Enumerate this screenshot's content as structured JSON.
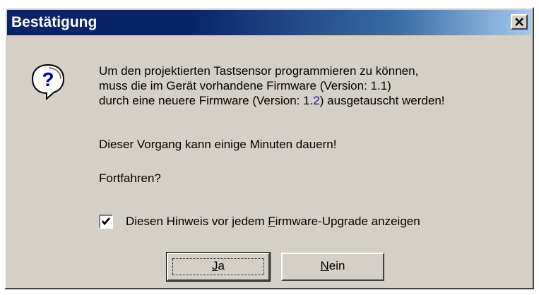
{
  "dialog": {
    "title": "Bestätigung",
    "close_label": "×",
    "icon": "question-icon",
    "message_lines": [
      {
        "text": "Um den projektierten Tastsensor programmieren zu können,"
      },
      {
        "text": "muss die im Gerät vorhandene Firmware (Version: 1.1)"
      },
      {
        "prefix": "durch eine neuere Firmware (Version: 1.",
        "highlight": "2",
        "suffix": ") ausgetauscht werden!"
      }
    ],
    "duration_text": "Dieser Vorgang kann einige Minuten dauern!",
    "question_text": "Fortfahren?",
    "checkbox": {
      "checked": true,
      "label_prefix": "Diesen Hinweis vor jedem ",
      "label_mnemonic": "F",
      "label_suffix": "irmware-Upgrade anzeigen"
    },
    "buttons": {
      "yes": {
        "mnemonic": "J",
        "rest": "a"
      },
      "no": {
        "mnemonic": "N",
        "rest": "ein"
      }
    },
    "colors": {
      "title_bar_start": "#0a246a",
      "title_bar_end": "#a6caf0",
      "face": "#d4d0c8",
      "highlight_digit": "#1a1aa8"
    }
  }
}
